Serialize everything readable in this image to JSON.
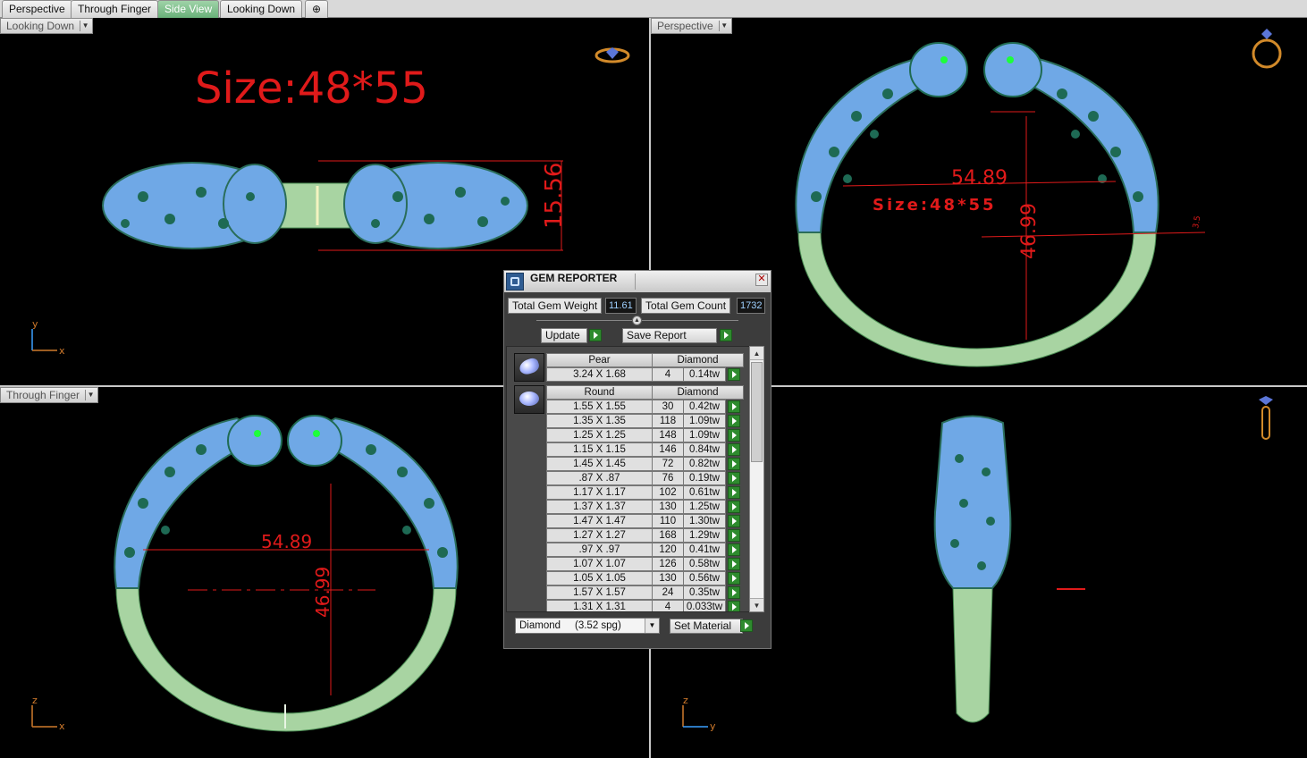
{
  "tabs": [
    {
      "label": "Perspective",
      "active": false
    },
    {
      "label": "Through Finger",
      "active": false
    },
    {
      "label": "Side View",
      "active": true
    },
    {
      "label": "Looking Down",
      "active": false
    }
  ],
  "add_tab_icon": "plus-icon",
  "viewports": {
    "top_left": {
      "label": "Looking Down",
      "title_text": "Size:48*55",
      "dimension": "15.56",
      "axis_v": "y",
      "axis_h": "x",
      "corner_icon": "ring-icon"
    },
    "top_right": {
      "label": "Perspective",
      "dim_width": "54.89",
      "dim_height": "46.99",
      "size_text": "Size:48*55",
      "small_dim": "3.5",
      "corner_icon": "ring-icon"
    },
    "bottom_left": {
      "label": "Through Finger",
      "dim_width": "54.89",
      "dim_height": "46.99",
      "axis_v": "z",
      "axis_h": "x"
    },
    "bottom_right": {
      "label": "",
      "axis_v": "z",
      "axis_h": "y",
      "corner_icon": "ring-icon"
    }
  },
  "gem_reporter": {
    "title": "GEM REPORTER",
    "total_weight_label": "Total Gem Weight",
    "total_weight_value": "11.61",
    "total_count_label": "Total Gem Count",
    "total_count_value": "1732",
    "update_label": "Update",
    "save_report_label": "Save Report",
    "groups": [
      {
        "shape": "Pear",
        "material": "Diamond",
        "icon": "pear-gem-icon",
        "rows": [
          [
            "3.24 X 1.68",
            "4",
            "0.14tw"
          ]
        ]
      },
      {
        "shape": "Round",
        "material": "Diamond",
        "icon": "round-gem-icon",
        "rows": [
          [
            "1.55 X 1.55",
            "30",
            "0.42tw"
          ],
          [
            "1.35 X 1.35",
            "118",
            "1.09tw"
          ],
          [
            "1.25 X 1.25",
            "148",
            "1.09tw"
          ],
          [
            "1.15 X 1.15",
            "146",
            "0.84tw"
          ],
          [
            "1.45 X 1.45",
            "72",
            "0.82tw"
          ],
          [
            ".87 X .87",
            "76",
            "0.19tw"
          ],
          [
            "1.17 X 1.17",
            "102",
            "0.61tw"
          ],
          [
            "1.37 X 1.37",
            "130",
            "1.25tw"
          ],
          [
            "1.47 X 1.47",
            "110",
            "1.30tw"
          ],
          [
            "1.27 X 1.27",
            "168",
            "1.29tw"
          ],
          [
            ".97 X .97",
            "120",
            "0.41tw"
          ],
          [
            "1.07 X 1.07",
            "126",
            "0.58tw"
          ],
          [
            "1.05 X 1.05",
            "130",
            "0.56tw"
          ],
          [
            "1.57 X 1.57",
            "24",
            "0.35tw"
          ],
          [
            "1.31 X 1.31",
            "4",
            "0.033tw"
          ]
        ]
      }
    ],
    "material_select": "Diamond     (3.52 spg)",
    "set_material_label": "Set Material"
  },
  "colors": {
    "gem_blue": "#6fa8e6",
    "metal_green": "#a8d4a2",
    "dimension_red": "#e01a1a",
    "accent_green": "#2e8b2e"
  }
}
